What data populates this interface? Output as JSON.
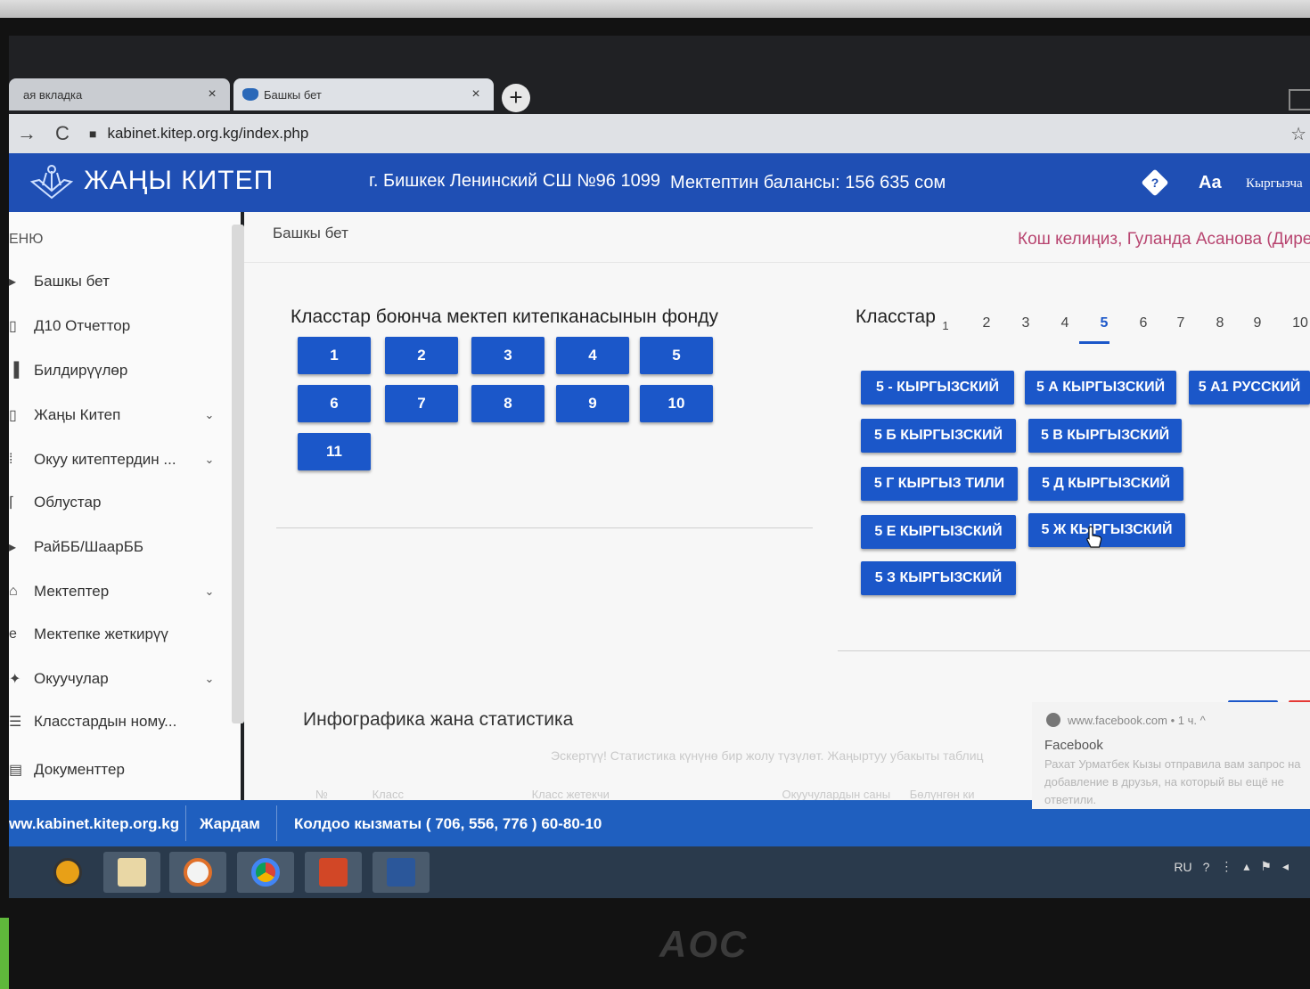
{
  "browser": {
    "tabs": [
      {
        "label": "ая вкладка",
        "close": "×"
      },
      {
        "label": "Башкы бет",
        "close": "×"
      }
    ],
    "new_tab": "+",
    "url": "kabinet.kitep.org.kg/index.php",
    "back_icon": "→",
    "reload_icon": "C",
    "star_icon": "☆"
  },
  "header": {
    "logo": "ЖАҢЫ КИТЕП",
    "school": "г. Бишкек Ленинский СШ №96 1099",
    "balance": "Мектептин балансы: 156 635 сом",
    "help": "?",
    "font_size": "Aa",
    "language": "Кыргызча"
  },
  "sidebar": {
    "title": "ЕНЮ",
    "items": [
      {
        "icon": "home-icon",
        "label": "Башкы бет"
      },
      {
        "icon": "report-icon",
        "label": "Д10 Отчеттор"
      },
      {
        "icon": "bell-icon",
        "label": "Билдирүүлөр"
      },
      {
        "icon": "book-icon",
        "label": "Жаңы Китеп",
        "chevron": "⌄"
      },
      {
        "icon": "books-icon",
        "label": "Окуу китептердин ...",
        "chevron": "⌄"
      },
      {
        "icon": "map-icon",
        "label": "Облустар"
      },
      {
        "icon": "pin-icon",
        "label": "РайББ/ШаарББ"
      },
      {
        "icon": "school-icon",
        "label": "Мектептер",
        "chevron": "⌄"
      },
      {
        "icon": "delivery-icon",
        "label": "Мектепке жеткирүү"
      },
      {
        "icon": "student-icon",
        "label": "Окуучулар",
        "chevron": "⌄"
      },
      {
        "icon": "list-icon",
        "label": "Класстардын ному..."
      },
      {
        "icon": "document-icon",
        "label": "Документтер"
      }
    ]
  },
  "main": {
    "breadcrumb": "Башкы бет",
    "welcome": "Кош келиңиз, Гуланда Асанова (Дире",
    "fund_title": "Класстар боюнча мектеп китепканасынын фонду",
    "grades": [
      "1",
      "2",
      "3",
      "4",
      "5",
      "6",
      "7",
      "8",
      "9",
      "10",
      "11"
    ],
    "classes_title": "Класстар",
    "class_tabs": [
      "1",
      "2",
      "3",
      "4",
      "5",
      "6",
      "7",
      "8",
      "9",
      "10"
    ],
    "active_tab": "5",
    "class_buttons": [
      "5 - КЫРГЫЗСКИЙ",
      "5 А КЫРГЫЗСКИЙ",
      "5 А1 РУССКИЙ",
      "5 Б КЫРГЫЗСКИЙ",
      "5 В КЫРГЫЗСКИЙ",
      "5 Г КЫРГЫЗ ТИЛИ",
      "5 Д КЫРГЫЗСКИЙ",
      "5 Е КЫРГЫЗСКИЙ",
      "5 Ж КЫРГЫЗСКИЙ",
      "5 З КЫРГЫЗСКИЙ"
    ],
    "info_title": "Инфографика жана статистика",
    "note": "Эскертүү! Статистика күнүнө бир жолу түзүлөт. Жаңыртуу убакыты таблиц",
    "table_headers": [
      "№",
      "Класс",
      "Класс жетекчи",
      "Окуучулардын саны",
      "Бөлүнгөн ки"
    ]
  },
  "notification": {
    "source": "www.facebook.com • 1 ч. ^",
    "title": "Facebook",
    "body": "Рахат Урматбек Кызы отправила вам запрос на добавление в друзья, на который вы ещё не ответили."
  },
  "footer": {
    "site": "ww.kabinet.kitep.org.kg",
    "help": "Жардам",
    "support": "Колдоо кызматы ( 706, 556, 776 ) 60-80-10"
  },
  "tray": {
    "lang": "RU"
  },
  "monitor_brand": "AOC",
  "colors": {
    "primary": "#1b57c9",
    "header": "#1f4fb4",
    "accent": "#b84570",
    "danger": "#e53935"
  }
}
